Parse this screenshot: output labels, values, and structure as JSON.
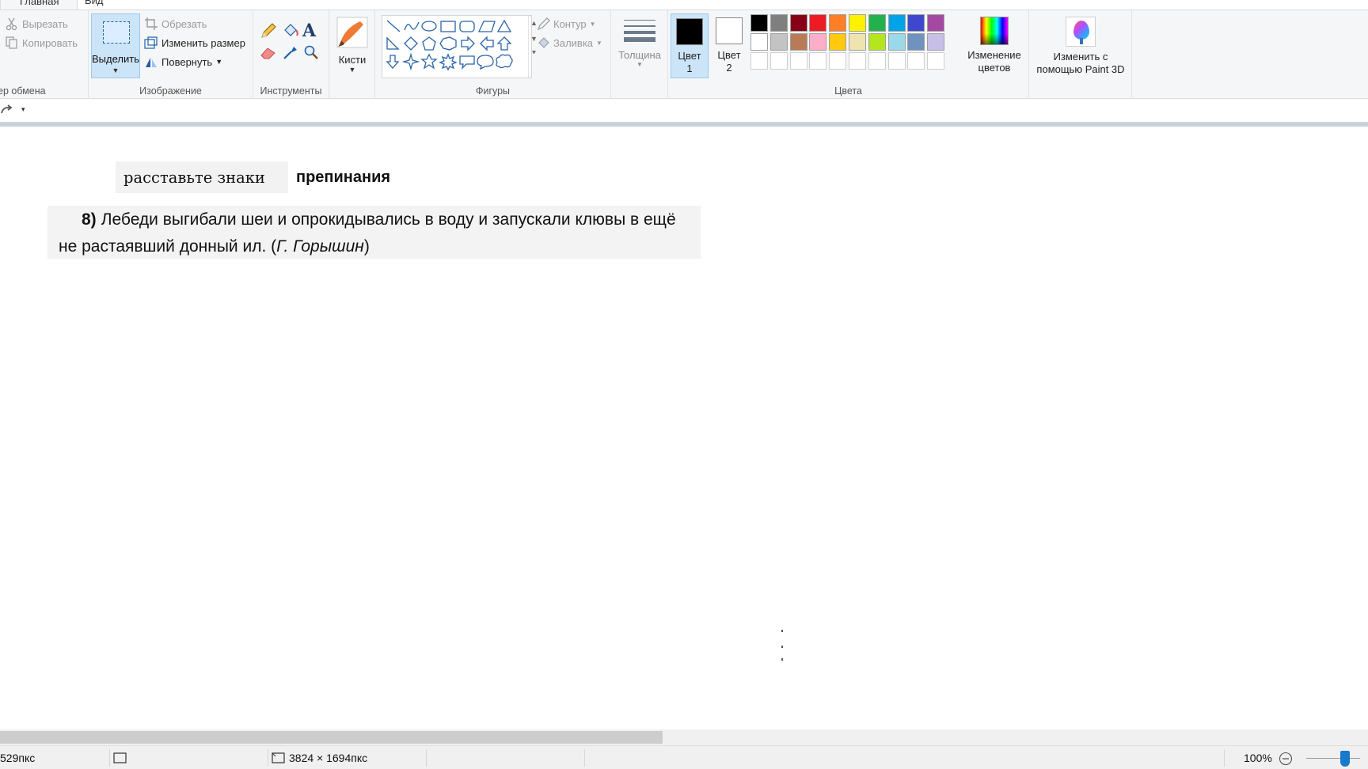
{
  "tabs": {
    "home": "Главная",
    "view": "Вид"
  },
  "clipboard": {
    "cut": "Вырезать",
    "copy": "Копировать",
    "label": "ер обмена"
  },
  "image": {
    "select": "Выделить",
    "crop": "Обрезать",
    "resize": "Изменить размер",
    "rotate": "Повернуть",
    "label": "Изображение"
  },
  "tools": {
    "label": "Инструменты"
  },
  "brushes": {
    "label": "Кисти"
  },
  "shapes": {
    "outline": "Контур",
    "fill": "Заливка",
    "label": "Фигуры"
  },
  "thickness": {
    "label": "Толщина"
  },
  "colors": {
    "color1_line1": "Цвет",
    "color1_line2": "1",
    "color2_line1": "Цвет",
    "color2_line2": "2",
    "edit_line1": "Изменение",
    "edit_line2": "цветов",
    "label": "Цвета",
    "color1_value": "#000000",
    "color2_value": "#ffffff",
    "palette_row1": [
      "#000000",
      "#7f7f7f",
      "#880015",
      "#ed1c24",
      "#ff7f27",
      "#fff200",
      "#22b14c",
      "#00a2e8",
      "#3f48cc",
      "#a349a4"
    ],
    "palette_row2": [
      "#ffffff",
      "#c3c3c3",
      "#b97a57",
      "#ffaec9",
      "#ffc90e",
      "#efe4b0",
      "#b5e61d",
      "#99d9ea",
      "#7092be",
      "#c8bfe7"
    ]
  },
  "paint3d": {
    "line1": "Изменить с",
    "line2": "помощью Paint 3D"
  },
  "canvas": {
    "fragment1_serif": "расставьте знаки",
    "fragment1_bold": "препинания",
    "fragment2_num": "8)",
    "fragment2_line1": "Лебеди выгибали шеи и опрокидывались в воду и запускали клювы в ещё",
    "fragment2_line2_start": "не растаявший донный ил. (",
    "fragment2_author": "Г. Горышин",
    "fragment2_line2_end": ")"
  },
  "status": {
    "cursor_pos": "529пкс",
    "image_size": "3824 × 1694пкс",
    "zoom": "100%",
    "zoom_fraction": 0.72
  }
}
